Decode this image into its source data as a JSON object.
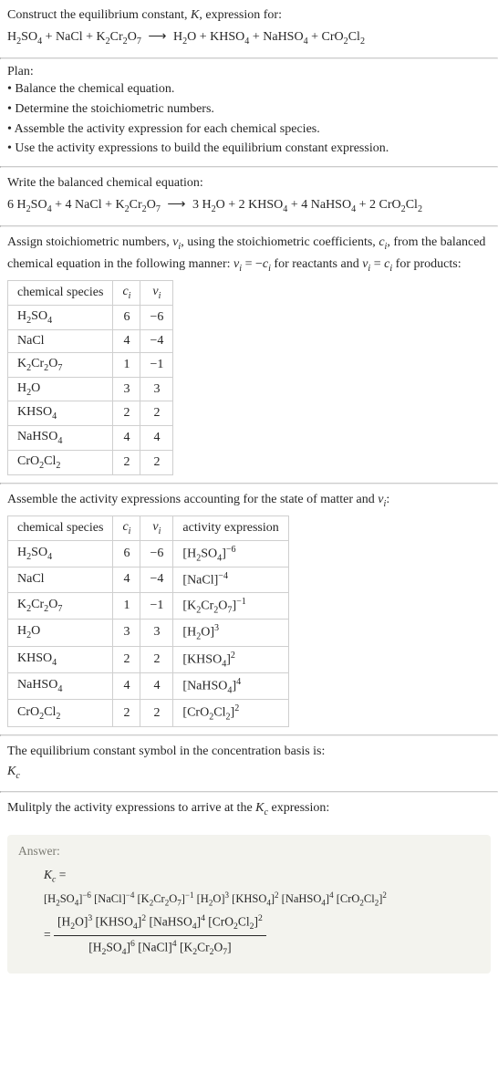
{
  "intro": {
    "line1_pre": "Construct the equilibrium constant, ",
    "line1_K": "K",
    "line1_post": ", expression for:"
  },
  "eq_unbalanced": {
    "lhs": [
      {
        "base": "H",
        "s1": "2",
        "base2": "SO",
        "s2": "4"
      },
      {
        "text": "NaCl"
      },
      {
        "base": "K",
        "s1": "2",
        "base2": "Cr",
        "s2": "2",
        "base3": "O",
        "s3": "7"
      }
    ],
    "rhs": [
      {
        "base": "H",
        "s1": "2",
        "base2": "O"
      },
      {
        "base": "KHSO",
        "s1": "4"
      },
      {
        "base": "NaHSO",
        "s1": "4"
      },
      {
        "base": "CrO",
        "s1": "2",
        "base2": "Cl",
        "s2": "2"
      }
    ],
    "arrow": "⟶"
  },
  "plan": {
    "title": "Plan:",
    "items": [
      "Balance the chemical equation.",
      "Determine the stoichiometric numbers.",
      "Assemble the activity expression for each chemical species.",
      "Use the activity expressions to build the equilibrium constant expression."
    ]
  },
  "balanced": {
    "title": "Write the balanced chemical equation:",
    "coeffs_lhs": [
      "6",
      "4",
      ""
    ],
    "coeffs_rhs": [
      "3",
      "2",
      "4",
      "2"
    ],
    "arrow": "⟶"
  },
  "assign": {
    "pre": "Assign stoichiometric numbers, ",
    "nu": "ν",
    "nu_sub": "i",
    "mid1": ", using the stoichiometric coefficients, ",
    "c": "c",
    "c_sub": "i",
    "mid2": ", from the balanced chemical equation in the following manner: ",
    "rel1_l": "ν",
    "rel1_ls": "i",
    "rel1_eq": " = −",
    "rel1_r": "c",
    "rel1_rs": "i",
    "mid3": " for reactants and ",
    "rel2_l": "ν",
    "rel2_ls": "i",
    "rel2_eq": " = ",
    "rel2_r": "c",
    "rel2_rs": "i",
    "mid4": " for products:"
  },
  "table1": {
    "head": [
      "chemical species",
      "c",
      "i",
      "ν",
      "i"
    ],
    "rows": [
      {
        "sp": {
          "a": "H",
          "as": "2",
          "b": "SO",
          "bs": "4"
        },
        "c": "6",
        "n": "−6"
      },
      {
        "sp": {
          "a": "NaCl"
        },
        "c": "4",
        "n": "−4"
      },
      {
        "sp": {
          "a": "K",
          "as": "2",
          "b": "Cr",
          "bs": "2",
          "c": "O",
          "cs": "7"
        },
        "c": "1",
        "n": "−1"
      },
      {
        "sp": {
          "a": "H",
          "as": "2",
          "b": "O"
        },
        "c": "3",
        "n": "3"
      },
      {
        "sp": {
          "a": "KHSO",
          "as": "4"
        },
        "c": "2",
        "n": "2"
      },
      {
        "sp": {
          "a": "NaHSO",
          "as": "4"
        },
        "c": "4",
        "n": "4"
      },
      {
        "sp": {
          "a": "CrO",
          "as": "2",
          "b": "Cl",
          "bs": "2"
        },
        "c": "2",
        "n": "2"
      }
    ]
  },
  "activity_title_pre": "Assemble the activity expressions accounting for the state of matter and ",
  "activity_title_nu": "ν",
  "activity_title_sub": "i",
  "activity_title_post": ":",
  "table2": {
    "head4": "activity expression",
    "rows": [
      {
        "exp": {
          "open": "[",
          "a": "H",
          "as": "2",
          "b": "SO",
          "bs": "4",
          "close": "]",
          "pow": "−6"
        }
      },
      {
        "exp": {
          "open": "[",
          "a": "NaCl",
          "close": "]",
          "pow": "−4"
        }
      },
      {
        "exp": {
          "open": "[",
          "a": "K",
          "as": "2",
          "b": "Cr",
          "bs": "2",
          "c": "O",
          "cs": "7",
          "close": "]",
          "pow": "−1"
        }
      },
      {
        "exp": {
          "open": "[",
          "a": "H",
          "as": "2",
          "b": "O",
          "close": "]",
          "pow": "3"
        }
      },
      {
        "exp": {
          "open": "[",
          "a": "KHSO",
          "as": "4",
          "close": "]",
          "pow": "2"
        }
      },
      {
        "exp": {
          "open": "[",
          "a": "NaHSO",
          "as": "4",
          "close": "]",
          "pow": "4"
        }
      },
      {
        "exp": {
          "open": "[",
          "a": "CrO",
          "as": "2",
          "b": "Cl",
          "bs": "2",
          "close": "]",
          "pow": "2"
        }
      }
    ]
  },
  "kc_text1": "The equilibrium constant symbol in the concentration basis is:",
  "kc_K": "K",
  "kc_c": "c",
  "mult_line_pre": "Mulitply the activity expressions to arrive at the ",
  "mult_line_post": " expression:",
  "answer": {
    "label": "Answer:",
    "eq_sym_K": "K",
    "eq_sym_c": "c",
    "eq_eq": " = ",
    "terms_flat": [
      {
        "a": "H",
        "as": "2",
        "b": "SO",
        "bs": "4",
        "pow": "−6"
      },
      {
        "a": "NaCl",
        "pow": "−4"
      },
      {
        "a": "K",
        "as": "2",
        "b": "Cr",
        "bs": "2",
        "c": "O",
        "cs": "7",
        "pow": "−1"
      },
      {
        "a": "H",
        "as": "2",
        "b": "O",
        "pow": "3"
      },
      {
        "a": "KHSO",
        "as": "4",
        "pow": "2"
      },
      {
        "a": "NaHSO",
        "as": "4",
        "pow": "4"
      },
      {
        "a": "CrO",
        "as": "2",
        "b": "Cl",
        "bs": "2",
        "pow": "2"
      }
    ],
    "num": [
      {
        "a": "H",
        "as": "2",
        "b": "O",
        "pow": "3"
      },
      {
        "a": "KHSO",
        "as": "4",
        "pow": "2"
      },
      {
        "a": "NaHSO",
        "as": "4",
        "pow": "4"
      },
      {
        "a": "CrO",
        "as": "2",
        "b": "Cl",
        "bs": "2",
        "pow": "2"
      }
    ],
    "den": [
      {
        "a": "H",
        "as": "2",
        "b": "SO",
        "bs": "4",
        "pow": "6"
      },
      {
        "a": "NaCl",
        "pow": "4"
      },
      {
        "a": "K",
        "as": "2",
        "b": "Cr",
        "bs": "2",
        "c": "O",
        "cs": "7",
        "pow": ""
      }
    ],
    "eq2": " = "
  },
  "chart_data": {
    "type": "table",
    "title": "Stoichiometric numbers and activity expressions",
    "columns": [
      "chemical species",
      "c_i",
      "ν_i",
      "activity expression"
    ],
    "rows": [
      [
        "H2SO4",
        6,
        -6,
        "[H2SO4]^-6"
      ],
      [
        "NaCl",
        4,
        -4,
        "[NaCl]^-4"
      ],
      [
        "K2Cr2O7",
        1,
        -1,
        "[K2Cr2O7]^-1"
      ],
      [
        "H2O",
        3,
        3,
        "[H2O]^3"
      ],
      [
        "KHSO4",
        2,
        2,
        "[KHSO4]^2"
      ],
      [
        "NaHSO4",
        4,
        4,
        "[NaHSO4]^4"
      ],
      [
        "CrO2Cl2",
        2,
        2,
        "[CrO2Cl2]^2"
      ]
    ]
  }
}
